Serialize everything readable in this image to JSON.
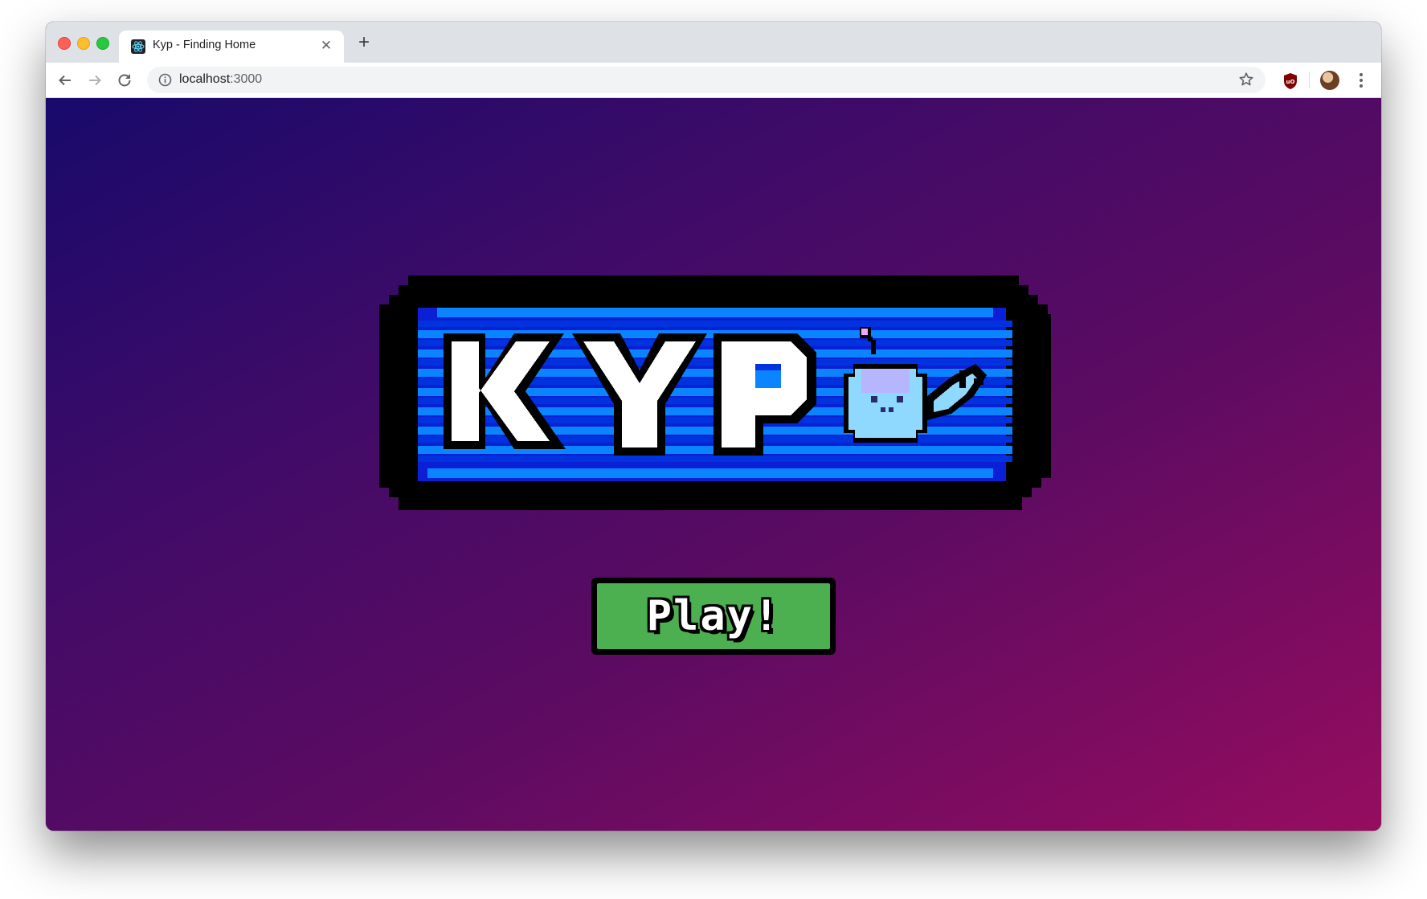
{
  "browser": {
    "tab": {
      "title": "Kyp - Finding Home",
      "close_icon": "close-icon",
      "favicon": "react-favicon"
    },
    "new_tab_icon": "plus-icon",
    "address": {
      "host": "localhost",
      "port": ":3000"
    },
    "icons": {
      "back": "arrow-left-icon",
      "forward": "arrow-right-icon",
      "reload": "reload-icon",
      "info": "info-icon",
      "bookmark": "star-icon",
      "extension": "ublock-icon",
      "profile": "avatar",
      "menu": "kebab-menu-icon"
    }
  },
  "page": {
    "logo_text": "KYP",
    "play_label": "Play!",
    "colors": {
      "gradient_start": "#180a6b",
      "gradient_end": "#950d5f",
      "logo_blue": "#0a84ff",
      "logo_dark_blue": "#0033dd",
      "play_green": "#4caf50"
    }
  }
}
